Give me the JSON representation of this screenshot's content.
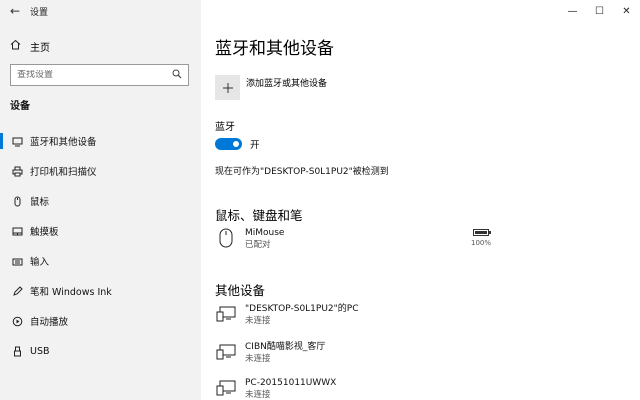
{
  "window": {
    "title": "设置",
    "back_icon": "←",
    "minimize": "—",
    "maximize": "☐",
    "close": "✕"
  },
  "sidebar": {
    "home_label": "主页",
    "search_placeholder": "查找设置",
    "section_label": "设备",
    "items": [
      {
        "label": "蓝牙和其他设备",
        "icon": "bluetooth-icon",
        "active": true
      },
      {
        "label": "打印机和扫描仪",
        "icon": "printer-icon"
      },
      {
        "label": "鼠标",
        "icon": "mouse-icon"
      },
      {
        "label": "触摸板",
        "icon": "touchpad-icon"
      },
      {
        "label": "输入",
        "icon": "keyboard-icon"
      },
      {
        "label": "笔和 Windows Ink",
        "icon": "pen-icon"
      },
      {
        "label": "自动播放",
        "icon": "autoplay-icon"
      },
      {
        "label": "USB",
        "icon": "usb-icon"
      }
    ]
  },
  "main": {
    "title": "蓝牙和其他设备",
    "add_device_label": "添加蓝牙或其他设备",
    "bluetooth_label": "蓝牙",
    "bluetooth_state": "开",
    "bluetooth_on": true,
    "discover_text": "现在可作为\"DESKTOP-S0L1PU2\"被检测到",
    "mouse_section": "鼠标、键盘和笔",
    "mouse_device": {
      "name": "MiMouse",
      "status": "已配对",
      "battery": "100%",
      "battery_level": 1.0
    },
    "other_section": "其他设备",
    "other_devices": [
      {
        "name": "\"DESKTOP-S0L1PU2\"的PC",
        "status": "未连接"
      },
      {
        "name": "CIBN酷喵影视_客厅",
        "status": "未连接"
      },
      {
        "name": "PC-20151011UWWX",
        "status": "未连接"
      }
    ]
  },
  "colors": {
    "accent": "#0078d7",
    "sidebar_bg": "#f2f2f2"
  }
}
